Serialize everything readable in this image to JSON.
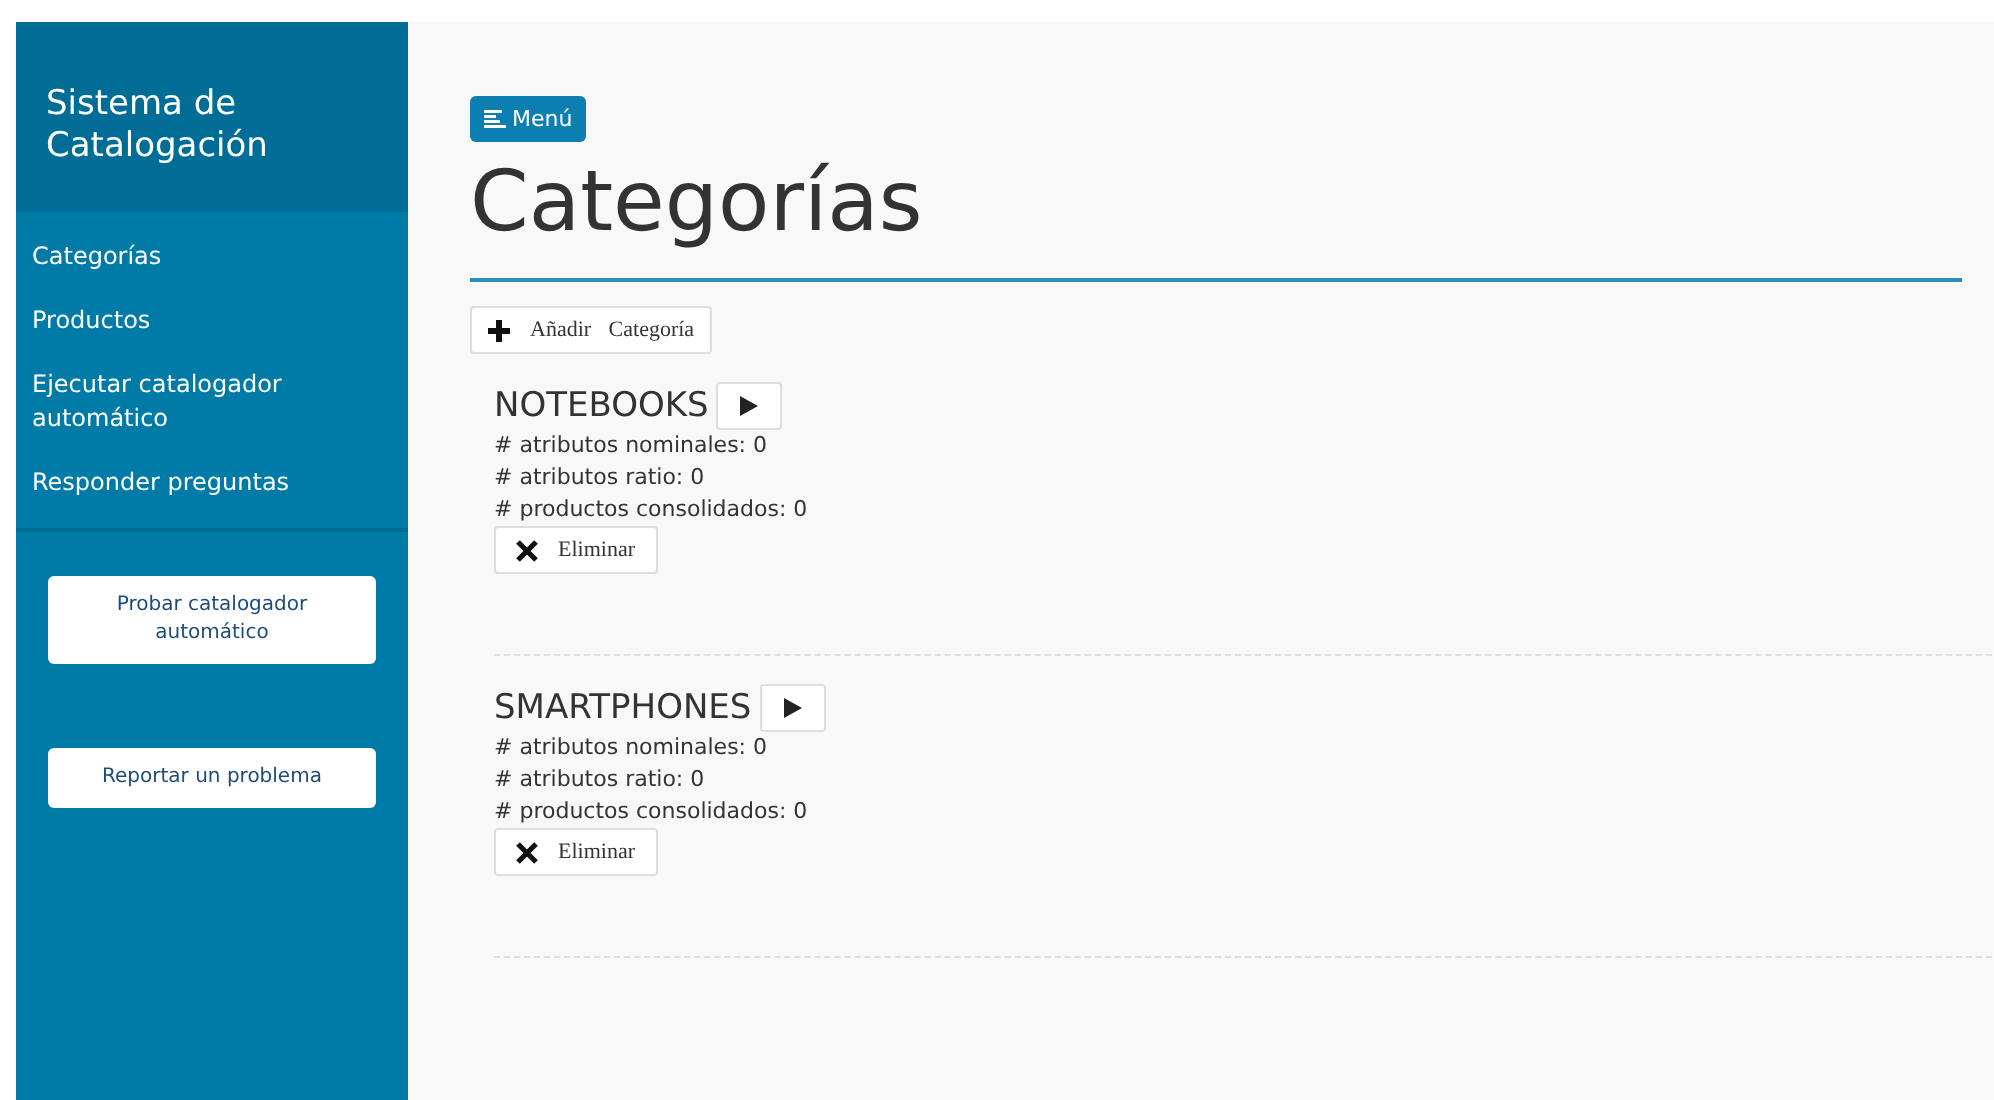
{
  "sidebar": {
    "title": "Sistema de Catalogación",
    "items": [
      {
        "label": "Categorías"
      },
      {
        "label": "Productos"
      },
      {
        "label": "Ejecutar catalogador automático"
      },
      {
        "label": "Responder preguntas"
      }
    ],
    "buttons": [
      "Probar catalogador automático",
      "Reportar un problema"
    ]
  },
  "menu_button": "Menú",
  "title": "Categorías",
  "add_button": "Añadir Categoría",
  "categories": [
    {
      "name": "NOTEBOOKS",
      "stats": [
        "# atributos nominales: 0",
        "# atributos ratio: 0",
        "# productos consolidados: 0"
      ],
      "delete": "Eliminar"
    },
    {
      "name": "SMARTPHONES",
      "stats": [
        "# atributos nominales: 0",
        "# atributos ratio: 0",
        "# productos consolidados: 0"
      ],
      "delete": "Eliminar"
    }
  ]
}
